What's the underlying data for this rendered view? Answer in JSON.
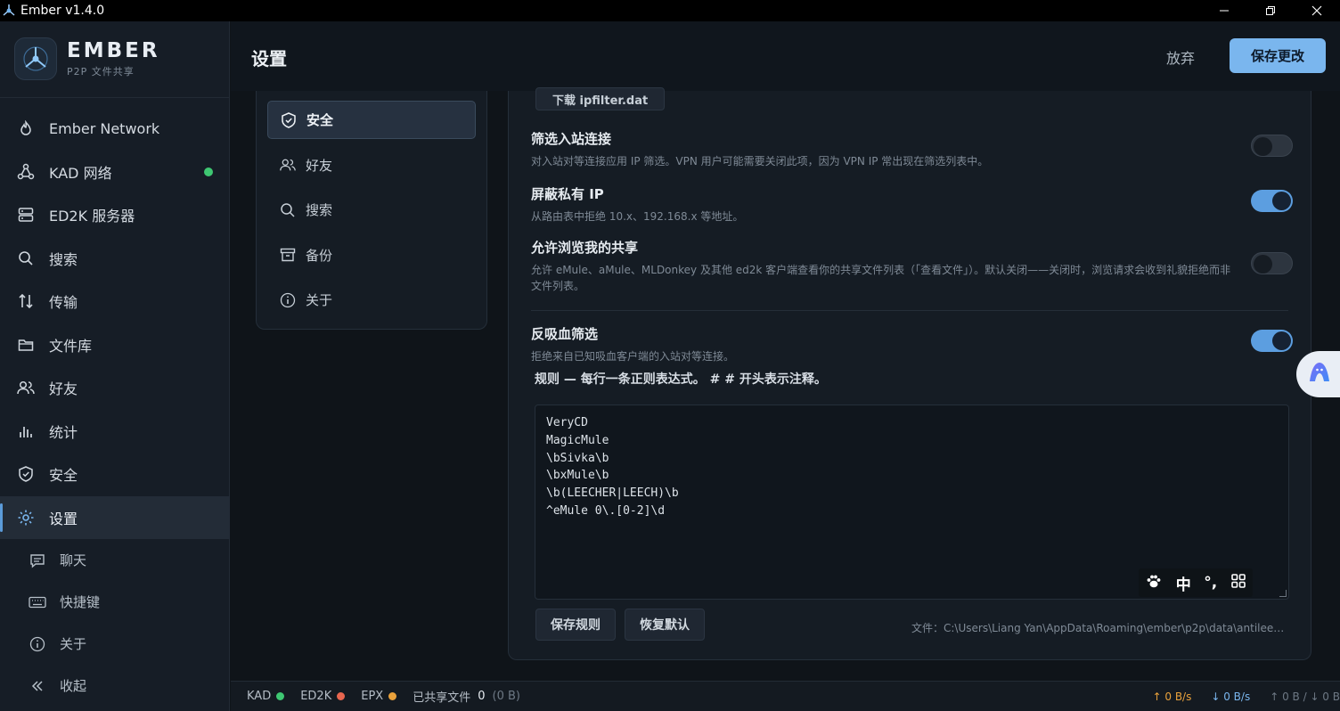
{
  "window": {
    "title": "Ember v1.4.0"
  },
  "brand": {
    "name": "EMBER",
    "subtitle": "P2P 文件共享"
  },
  "sidebar": {
    "items": [
      {
        "label": "Ember Network",
        "icon": "flame-icon"
      },
      {
        "label": "KAD 网络",
        "icon": "network-icon",
        "status_dot": "#3ec772"
      },
      {
        "label": "ED2K 服务器",
        "icon": "server-icon"
      },
      {
        "label": "搜索",
        "icon": "search-icon"
      },
      {
        "label": "传输",
        "icon": "transfer-icon"
      },
      {
        "label": "文件库",
        "icon": "folder-icon"
      },
      {
        "label": "好友",
        "icon": "friends-icon"
      },
      {
        "label": "统计",
        "icon": "stats-icon"
      },
      {
        "label": "安全",
        "icon": "shield-icon"
      },
      {
        "label": "设置",
        "icon": "gear-icon",
        "active": true
      }
    ],
    "sub_items": [
      {
        "label": "聊天",
        "icon": "chat-icon"
      },
      {
        "label": "快捷键",
        "icon": "keyboard-icon"
      },
      {
        "label": "关于",
        "icon": "info-icon"
      },
      {
        "label": "收起",
        "icon": "collapse-icon"
      }
    ]
  },
  "header": {
    "title": "设置",
    "discard_label": "放弃",
    "save_label": "保存更改"
  },
  "settings_nav": {
    "items": [
      {
        "label": "安全",
        "icon": "shield-check-icon",
        "active": true
      },
      {
        "label": "好友",
        "icon": "friends-icon"
      },
      {
        "label": "搜索",
        "icon": "search-icon"
      },
      {
        "label": "备份",
        "icon": "archive-icon"
      },
      {
        "label": "关于",
        "icon": "info-icon"
      }
    ]
  },
  "panel": {
    "download_button": "下载 ipfilter.dat",
    "settings": [
      {
        "title": "筛选入站连接",
        "desc": "对入站对等连接应用 IP 筛选。VPN 用户可能需要关闭此项，因为 VPN IP 常出现在筛选列表中。",
        "enabled": false
      },
      {
        "title": "屏蔽私有 IP",
        "desc": "从路由表中拒绝 10.x、192.168.x 等地址。",
        "enabled": true
      },
      {
        "title": "允许浏览我的共享",
        "desc": "允许 eMule、aMule、MLDonkey 及其他 ed2k 客户端查看你的共享文件列表（「查看文件」）。默认关闭——关闭时，浏览请求会收到礼貌拒绝而非文件列表。",
        "enabled": false
      },
      {
        "title": "反吸血筛选",
        "desc": "拒绝来自已知吸血客户端的入站对等连接。",
        "enabled": true
      }
    ],
    "rules_label": "规则 — 每行一条正则表达式。 # # 开头表示注释。",
    "rules": [
      "VeryCD",
      "MagicMule",
      "\\bSivka\\b",
      "\\bxMule\\b",
      "\\b(LEECHER|LEECH)\\b",
      "^eMule 0\\.[0-2]\\d"
    ],
    "save_rules_label": "保存规则",
    "restore_default_label": "恢复默认",
    "file_path": "文件：C:\\Users\\Liang Yan\\AppData\\Roaming\\ember\\p2p\\data\\antileech..."
  },
  "ime": {
    "mode": "中",
    "punct": "°,",
    "icon": "paw-icon"
  },
  "statusbar": {
    "kad": {
      "label": "KAD",
      "color": "#3ec772"
    },
    "ed2k": {
      "label": "ED2K",
      "color": "#e8664f"
    },
    "epx": {
      "label": "EPX",
      "color": "#e9a13b"
    },
    "shared_label": "已共享文件",
    "shared_count": "0",
    "shared_size": "(0 B)",
    "upload": "↑ 0 B/s",
    "download": "↓ 0 B/s",
    "total": "↑ 0 B / ↓ 0 B"
  },
  "colors": {
    "accent": "#7ab6ee",
    "toggle_on": "#5c9ee0",
    "upload": "#e9a13b",
    "download": "#7ab6ee"
  }
}
